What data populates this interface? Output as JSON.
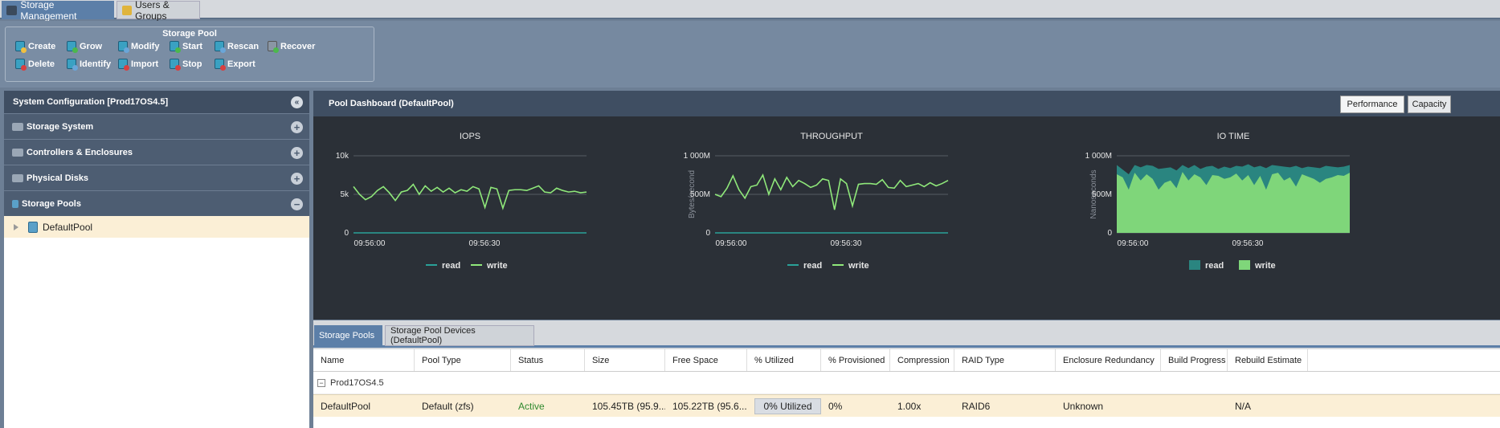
{
  "tabs": [
    {
      "label": "Storage Management",
      "active": true
    },
    {
      "label": "Users & Groups",
      "active": false
    }
  ],
  "ribbon": {
    "group_title": "Storage Pool",
    "buttons": [
      {
        "label": "Create",
        "icon": "pool-create-icon"
      },
      {
        "label": "Grow",
        "icon": "pool-grow-icon"
      },
      {
        "label": "Modify",
        "icon": "pool-modify-icon"
      },
      {
        "label": "Start",
        "icon": "pool-start-icon"
      },
      {
        "label": "Rescan",
        "icon": "pool-rescan-icon"
      },
      {
        "label": "Recover",
        "icon": "pool-recover-icon"
      },
      {
        "label": "Delete",
        "icon": "pool-delete-icon"
      },
      {
        "label": "Identify",
        "icon": "pool-identify-icon"
      },
      {
        "label": "Import",
        "icon": "pool-import-icon"
      },
      {
        "label": "Stop",
        "icon": "pool-stop-icon"
      },
      {
        "label": "Export",
        "icon": "pool-export-icon"
      }
    ]
  },
  "left_panel": {
    "title": "System Configuration [Prod17OS4.5]",
    "sections": [
      {
        "label": "Storage System",
        "expanded": false
      },
      {
        "label": "Controllers & Enclosures",
        "expanded": false
      },
      {
        "label": "Physical Disks",
        "expanded": false
      },
      {
        "label": "Storage Pools",
        "expanded": true
      }
    ],
    "tree_item": "DefaultPool"
  },
  "dashboard": {
    "title": "Pool Dashboard (DefaultPool)",
    "buttons": [
      "Performance",
      "Capacity"
    ]
  },
  "colors": {
    "read": "#2aa198",
    "write": "#8fe87a",
    "read_area": "#2a8580",
    "write_area": "#7fd67a",
    "bg": "#2b3037"
  },
  "chart_data": [
    {
      "type": "line",
      "title": "IOPS",
      "ylabel": "",
      "ylim": [
        0,
        10000
      ],
      "yticks": [
        "0",
        "5k",
        "10k"
      ],
      "xticks": [
        "09:56:00",
        "09:56:30"
      ],
      "series": [
        {
          "name": "read",
          "values": [
            0,
            0,
            0,
            0,
            0,
            0,
            0,
            0,
            0,
            0,
            0,
            0,
            0,
            0,
            0,
            0,
            0,
            0,
            0,
            0,
            0,
            0,
            0,
            0,
            0,
            0,
            0,
            0,
            0,
            0,
            0,
            0,
            0,
            0,
            0,
            0,
            0,
            0,
            0,
            0
          ]
        },
        {
          "name": "write",
          "values": [
            6000,
            5000,
            4300,
            4700,
            5500,
            6000,
            5200,
            4200,
            5300,
            5500,
            6300,
            5000,
            6100,
            5400,
            5900,
            5300,
            5800,
            5200,
            5600,
            5400,
            6000,
            5700,
            3300,
            5900,
            5700,
            3200,
            5500,
            5600,
            5600,
            5500,
            5800,
            6100,
            5300,
            5200,
            5800,
            5500,
            5300,
            5400,
            5200,
            5300
          ]
        }
      ]
    },
    {
      "type": "line",
      "title": "THROUGHPUT",
      "ylabel": "Bytes/second",
      "ylim": [
        0,
        1000
      ],
      "yticks": [
        "0",
        "500M",
        "1 000M"
      ],
      "xticks": [
        "09:56:00",
        "09:56:30"
      ],
      "series": [
        {
          "name": "read",
          "values": [
            0,
            0,
            0,
            0,
            0,
            0,
            0,
            0,
            0,
            0,
            0,
            0,
            0,
            0,
            0,
            0,
            0,
            0,
            0,
            0,
            0,
            0,
            0,
            0,
            0,
            0,
            0,
            0,
            0,
            0,
            0,
            0,
            0,
            0,
            0,
            0,
            0,
            0,
            0,
            0
          ]
        },
        {
          "name": "write",
          "values": [
            500,
            470,
            580,
            740,
            560,
            450,
            600,
            620,
            750,
            500,
            700,
            560,
            720,
            600,
            680,
            640,
            590,
            620,
            700,
            680,
            300,
            700,
            640,
            350,
            630,
            640,
            640,
            630,
            690,
            590,
            580,
            680,
            600,
            620,
            640,
            600,
            650,
            610,
            640,
            680
          ]
        }
      ]
    },
    {
      "type": "area",
      "title": "IO TIME",
      "ylabel": "Nanoseconds",
      "ylim": [
        0,
        1000
      ],
      "yticks": [
        "0",
        "500M",
        "1 000M"
      ],
      "xticks": [
        "09:56:00",
        "09:56:30"
      ],
      "series": [
        {
          "name": "read",
          "values": [
            880,
            820,
            760,
            880,
            850,
            880,
            870,
            830,
            840,
            850,
            810,
            880,
            840,
            880,
            830,
            860,
            870,
            830,
            860,
            840,
            870,
            860,
            890,
            850,
            870,
            840,
            880,
            870,
            860,
            850,
            870,
            840,
            860,
            850,
            840,
            870,
            860,
            850,
            860,
            880
          ]
        },
        {
          "name": "write",
          "values": [
            760,
            720,
            560,
            780,
            680,
            760,
            700,
            560,
            650,
            680,
            580,
            790,
            680,
            760,
            720,
            620,
            750,
            740,
            700,
            720,
            770,
            680,
            750,
            620,
            740,
            560,
            760,
            780,
            680,
            720,
            600,
            760,
            730,
            700,
            650,
            700,
            720,
            750,
            740,
            780
          ]
        }
      ]
    }
  ],
  "legend": {
    "read": "read",
    "write": "write"
  },
  "bottom": {
    "tabs": [
      "Storage Pools",
      "Storage Pool Devices (DefaultPool)"
    ],
    "columns": [
      "Name",
      "Pool Type",
      "Status",
      "Size",
      "Free Space",
      "% Utilized",
      "% Provisioned",
      "Compression",
      "RAID Type",
      "Enclosure Redundancy",
      "Build Progress",
      "Rebuild Estimate"
    ],
    "group": "Prod17OS4.5",
    "row": {
      "name": "DefaultPool",
      "pool_type": "Default (zfs)",
      "status": "Active",
      "size": "105.45TB (95.9...",
      "free": "105.22TB (95.6...",
      "utilized": "0% Utilized",
      "provisioned": "0%",
      "compression": "1.00x",
      "raid": "RAID6",
      "enclosure": "Unknown",
      "build": "",
      "rebuild": "N/A"
    }
  }
}
